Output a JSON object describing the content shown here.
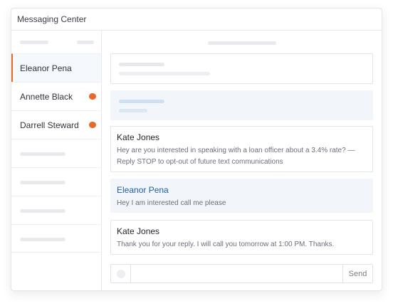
{
  "window": {
    "title": "Messaging Center"
  },
  "contacts": [
    {
      "name": "Eleanor Pena",
      "active": true,
      "unread": false
    },
    {
      "name": "Annette Black",
      "active": false,
      "unread": true
    },
    {
      "name": "Darrell Steward",
      "active": false,
      "unread": true
    }
  ],
  "messages": [
    {
      "sender": "Kate Jones",
      "text": "Hey are you interested in speaking with a loan officer about a 3.4% rate? — Reply STOP to opt-out of future text communications"
    },
    {
      "sender": "Eleanor Pena",
      "text": "Hey I am interested call me please"
    },
    {
      "sender": "Kate Jones",
      "text": "Thank you for your reply. I will call you tomorrow at 1:00 PM. Thanks."
    }
  ],
  "composer": {
    "placeholder": "",
    "send_label": "Send"
  },
  "colors": {
    "accent": "#e8692a",
    "link": "#1e5fa8",
    "tint": "#f2f6fb"
  }
}
